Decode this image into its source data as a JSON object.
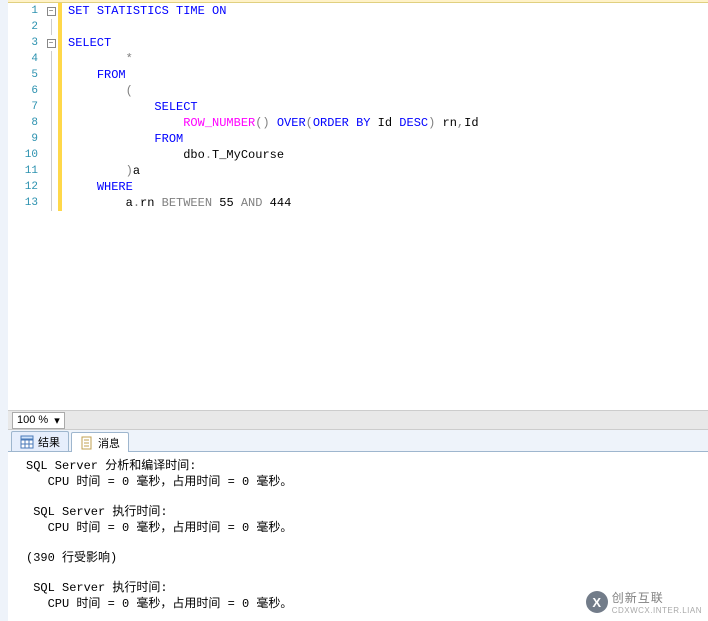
{
  "code": {
    "lines": [
      {
        "n": "1",
        "fold": "box",
        "indent": 0,
        "segs": [
          {
            "t": "SET",
            "c": "kw"
          },
          {
            "t": " ",
            "c": "black"
          },
          {
            "t": "STATISTICS",
            "c": "kw"
          },
          {
            "t": " ",
            "c": "black"
          },
          {
            "t": "TIME",
            "c": "kw"
          },
          {
            "t": " ",
            "c": "black"
          },
          {
            "t": "ON",
            "c": "kw"
          }
        ]
      },
      {
        "n": "2",
        "fold": "line",
        "indent": 0,
        "segs": []
      },
      {
        "n": "3",
        "fold": "box",
        "indent": 0,
        "segs": [
          {
            "t": "SELECT",
            "c": "kw"
          }
        ]
      },
      {
        "n": "4",
        "fold": "line",
        "indent": 2,
        "segs": [
          {
            "t": "*",
            "c": "gray"
          }
        ]
      },
      {
        "n": "5",
        "fold": "line",
        "indent": 1,
        "segs": [
          {
            "t": "FROM",
            "c": "kw"
          }
        ]
      },
      {
        "n": "6",
        "fold": "line",
        "indent": 2,
        "segs": [
          {
            "t": "(",
            "c": "gray"
          }
        ]
      },
      {
        "n": "7",
        "fold": "line",
        "indent": 3,
        "segs": [
          {
            "t": "SELECT",
            "c": "kw"
          }
        ]
      },
      {
        "n": "8",
        "fold": "line",
        "indent": 4,
        "segs": [
          {
            "t": "ROW_NUMBER",
            "c": "fn"
          },
          {
            "t": "()",
            "c": "gray"
          },
          {
            "t": " ",
            "c": "black"
          },
          {
            "t": "OVER",
            "c": "kw"
          },
          {
            "t": "(",
            "c": "gray"
          },
          {
            "t": "ORDER",
            "c": "kw"
          },
          {
            "t": " ",
            "c": "black"
          },
          {
            "t": "BY",
            "c": "kw"
          },
          {
            "t": " Id ",
            "c": "black"
          },
          {
            "t": "DESC",
            "c": "kw"
          },
          {
            "t": ")",
            "c": "gray"
          },
          {
            "t": " rn",
            "c": "black"
          },
          {
            "t": ",",
            "c": "gray"
          },
          {
            "t": "Id",
            "c": "black"
          }
        ]
      },
      {
        "n": "9",
        "fold": "line",
        "indent": 3,
        "segs": [
          {
            "t": "FROM",
            "c": "kw"
          }
        ]
      },
      {
        "n": "10",
        "fold": "line",
        "indent": 4,
        "segs": [
          {
            "t": "dbo",
            "c": "black"
          },
          {
            "t": ".",
            "c": "gray"
          },
          {
            "t": "T_MyCourse",
            "c": "black"
          }
        ]
      },
      {
        "n": "11",
        "fold": "line",
        "indent": 2,
        "segs": [
          {
            "t": ")",
            "c": "gray"
          },
          {
            "t": "a",
            "c": "black"
          }
        ]
      },
      {
        "n": "12",
        "fold": "line",
        "indent": 1,
        "segs": [
          {
            "t": "WHERE",
            "c": "kw"
          }
        ]
      },
      {
        "n": "13",
        "fold": "end",
        "indent": 2,
        "segs": [
          {
            "t": "a",
            "c": "black"
          },
          {
            "t": ".",
            "c": "gray"
          },
          {
            "t": "rn ",
            "c": "black"
          },
          {
            "t": "BETWEEN",
            "c": "gray"
          },
          {
            "t": " 55 ",
            "c": "black"
          },
          {
            "t": "AND",
            "c": "gray"
          },
          {
            "t": " 444",
            "c": "black"
          }
        ]
      }
    ]
  },
  "zoom": {
    "value": "100 %"
  },
  "tabs": {
    "results": "结果",
    "messages": "消息"
  },
  "messages": {
    "blocks": [
      [
        "SQL Server 分析和编译时间:",
        "   CPU 时间 = 0 毫秒，占用时间 = 0 毫秒。"
      ],
      [
        " SQL Server 执行时间:",
        "   CPU 时间 = 0 毫秒，占用时间 = 0 毫秒。"
      ],
      [
        "(390 行受影响)"
      ],
      [
        " SQL Server 执行时间:",
        "   CPU 时间 = 0 毫秒，占用时间 = 0 毫秒。"
      ]
    ]
  },
  "watermark": {
    "logo_letter": "X",
    "cn": "创新互联",
    "en": "CDXWCX.INTER.LIAN"
  }
}
